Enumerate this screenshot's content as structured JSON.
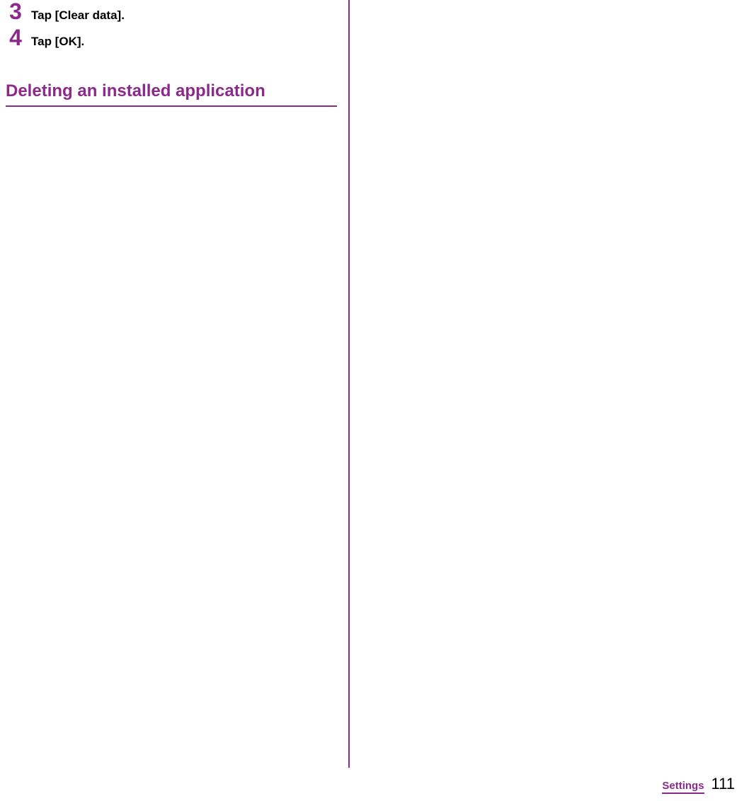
{
  "steps": [
    {
      "number": "3",
      "text": "Tap [Clear data]."
    },
    {
      "number": "4",
      "text": "Tap [OK]."
    }
  ],
  "section_heading": "Deleting an installed application",
  "footer": {
    "label": "Settings",
    "page": "111"
  }
}
